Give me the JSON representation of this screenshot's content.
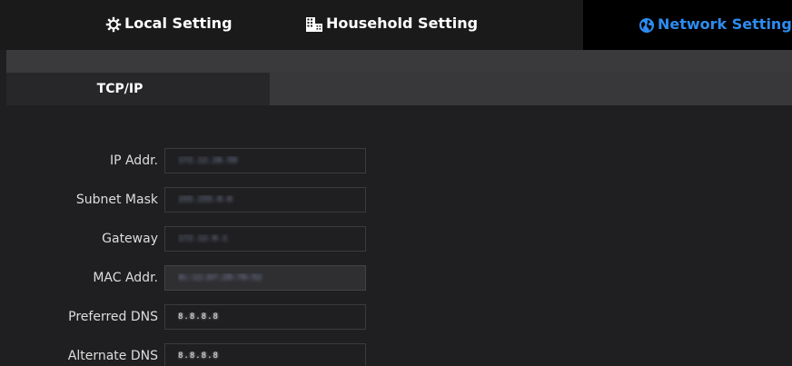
{
  "nav": {
    "tabs": [
      {
        "label": "Local Setting",
        "icon": "gear-icon"
      },
      {
        "label": "Household Setting",
        "icon": "building-icon"
      },
      {
        "label": "Network Setting",
        "icon": "globe-icon",
        "active": true
      }
    ],
    "active_color": "#2d8cf0"
  },
  "subtabs": [
    {
      "label": "TCP/IP",
      "active": true
    }
  ],
  "form": {
    "fields": [
      {
        "label": "IP Addr.",
        "value": "172.12.26.50"
      },
      {
        "label": "Subnet Mask",
        "value": "255.255.0.0"
      },
      {
        "label": "Gateway",
        "value": "172.12.0.1"
      },
      {
        "label": "MAC Addr.",
        "value": "4c:11:bf:20:76:52"
      },
      {
        "label": "Preferred DNS",
        "value": "8.8.8.8"
      },
      {
        "label": "Alternate DNS",
        "value": "8.8.8.8"
      }
    ]
  }
}
